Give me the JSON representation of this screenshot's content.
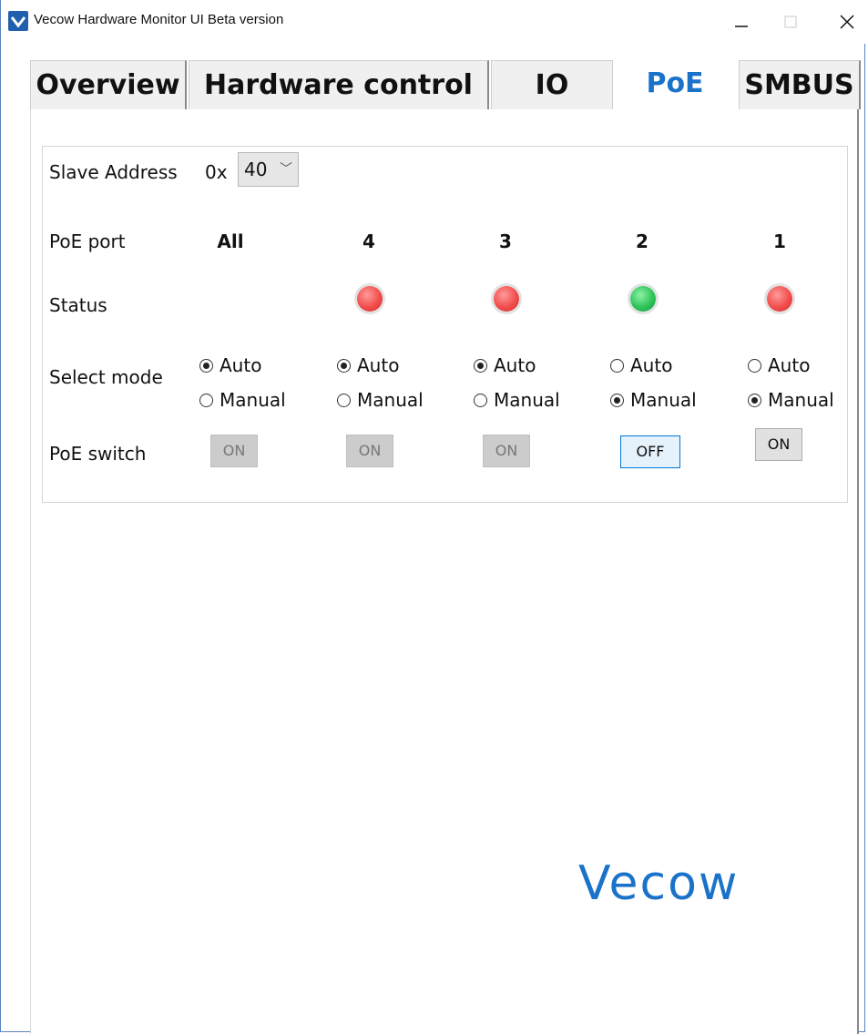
{
  "window": {
    "title": "Vecow Hardware Monitor UI Beta version",
    "icon": "vecow-check-icon",
    "accent": "#1f5fae"
  },
  "tabs": [
    {
      "label": "Overview"
    },
    {
      "label": "Hardware control"
    },
    {
      "label": "IO"
    },
    {
      "label": "PoE",
      "active": true
    },
    {
      "label": "SMBUS"
    }
  ],
  "poe": {
    "slave_label": "Slave Address",
    "slave_prefix": "0x",
    "slave_value": "40",
    "port_label": "PoE port",
    "status_label": "Status",
    "mode_label": "Select mode",
    "switch_label": "PoE switch",
    "ports": [
      {
        "name": "All",
        "status": null,
        "mode": "auto",
        "auto_label": "Auto",
        "manual_label": "Manual",
        "switch": "ON",
        "switch_state": "disabled"
      },
      {
        "name": "4",
        "status": "off",
        "mode": "auto",
        "auto_label": "Auto",
        "manual_label": "Manual",
        "switch": "ON",
        "switch_state": "disabled"
      },
      {
        "name": "3",
        "status": "off",
        "mode": "auto",
        "auto_label": "Auto",
        "manual_label": "Manual",
        "switch": "ON",
        "switch_state": "disabled"
      },
      {
        "name": "2",
        "status": "on",
        "mode": "manual",
        "auto_label": "Auto",
        "manual_label": "Manual",
        "switch": "OFF",
        "switch_state": "focused"
      },
      {
        "name": "1",
        "status": "off",
        "mode": "manual",
        "auto_label": "Auto",
        "manual_label": "Manual",
        "switch": "ON",
        "switch_state": "normal"
      }
    ],
    "status_colors": {
      "on": "#2ec45a",
      "off": "#f24d4d"
    }
  },
  "logo": {
    "text": "Vecow",
    "color": "#1a73c9"
  }
}
